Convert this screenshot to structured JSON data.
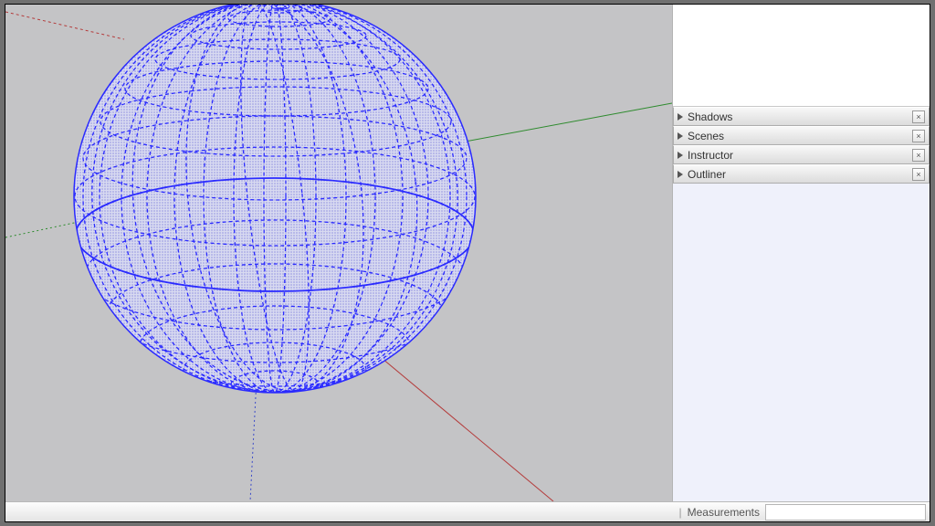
{
  "panels": [
    {
      "label": "Shadows"
    },
    {
      "label": "Scenes"
    },
    {
      "label": "Instructor"
    },
    {
      "label": "Outliner"
    }
  ],
  "status": {
    "measurements_label": "Measurements",
    "measurements_value": ""
  },
  "axes": {
    "colors": {
      "x": "#b43b3b",
      "y": "#2e8b2e",
      "z": "#3a49c9"
    }
  },
  "sphere": {
    "selected": true,
    "edge_color": "#2b2bff",
    "fill_tint": "#c7cdfb"
  }
}
